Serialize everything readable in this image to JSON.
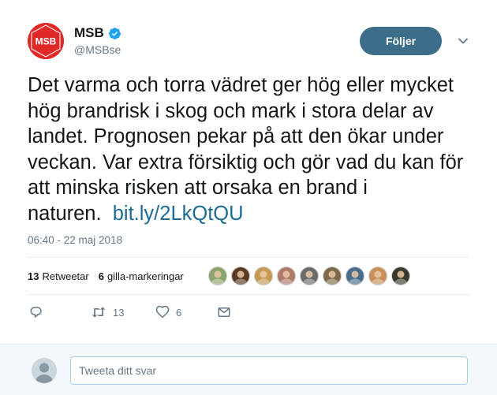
{
  "author": {
    "name": "MSB",
    "handle": "@MSBse",
    "avatar_text": "MSB",
    "brand_color": "#e02826",
    "verified": true
  },
  "follow_button": {
    "label": "Följer"
  },
  "tweet": {
    "text": "Det varma och torra vädret ger hög eller mycket hög brandrisk i skog och mark i stora delar av landet. Prognosen pekar på att den ökar under veckan. Var extra försiktig och gör vad du kan för att minska risken att orsaka en brand i naturen.",
    "link": "bit.ly/2LkQtQU",
    "timestamp": "06:40 - 22 maj 2018"
  },
  "stats": {
    "retweets_count": "13",
    "retweets_label": "Retweetar",
    "likes_count": "6",
    "likes_label": "gilla-markeringar"
  },
  "actions": {
    "retweet_count": "13",
    "like_count": "6"
  },
  "likers": [
    {
      "color": "#8aa56a"
    },
    {
      "color": "#5a3a22"
    },
    {
      "color": "#c79a54"
    },
    {
      "color": "#b07a6a"
    },
    {
      "color": "#6b6b6b"
    },
    {
      "color": "#7d6a4a"
    },
    {
      "color": "#4a6b8a"
    },
    {
      "color": "#c89058"
    },
    {
      "color": "#3a3a2a"
    }
  ],
  "reply": {
    "placeholder": "Tweeta ditt svar"
  },
  "colors": {
    "link": "#1b6d95",
    "follow_button_bg": "#3c6d89",
    "muted": "#657786"
  }
}
